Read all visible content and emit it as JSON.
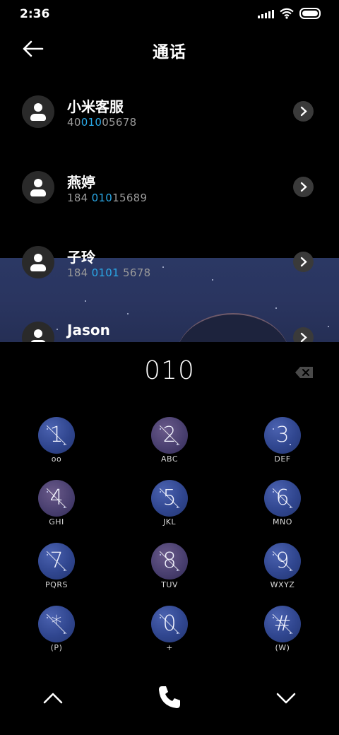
{
  "status_bar": {
    "time": "2:36"
  },
  "header": {
    "title": "通话"
  },
  "contacts": [
    {
      "name": "小米客服",
      "number_parts": [
        "40",
        "010",
        "05678"
      ]
    },
    {
      "name": "燕婷",
      "number_parts": [
        "184 ",
        "010",
        "15689"
      ]
    },
    {
      "name": "子玲",
      "number_parts": [
        "184 ",
        "0101",
        " 5678"
      ]
    },
    {
      "name": "Jason",
      "number_parts": [
        "",
        "",
        ""
      ]
    }
  ],
  "dialer": {
    "input": "010",
    "keys": [
      {
        "digit": "1",
        "letters": "oo"
      },
      {
        "digit": "2",
        "letters": "ABC"
      },
      {
        "digit": "3",
        "letters": "DEF"
      },
      {
        "digit": "4",
        "letters": "GHI"
      },
      {
        "digit": "5",
        "letters": "JKL"
      },
      {
        "digit": "6",
        "letters": "MNO"
      },
      {
        "digit": "7",
        "letters": "PQRS"
      },
      {
        "digit": "8",
        "letters": "TUV"
      },
      {
        "digit": "9",
        "letters": "WXYZ"
      },
      {
        "digit": "*",
        "letters": "(P)"
      },
      {
        "digit": "0",
        "letters": "+"
      },
      {
        "digit": "#",
        "letters": "(W)"
      }
    ]
  },
  "bottom_bar": {
    "left_icon": "chevron-up-icon",
    "center_icon": "phone-icon",
    "right_icon": "chevron-down-icon"
  },
  "colors": {
    "highlight": "#2aa9e8",
    "background": "#000000"
  }
}
